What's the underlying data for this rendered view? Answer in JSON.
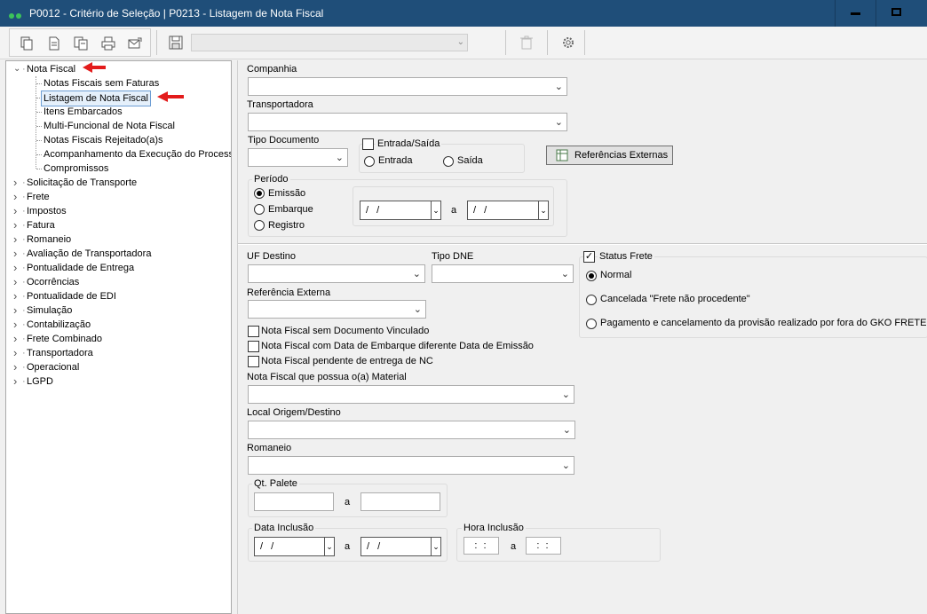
{
  "window": {
    "title": "P0012 - Critério de Seleção | P0213 - Listagem de Nota Fiscal",
    "accent": "#1f4e79"
  },
  "toolbar": {
    "icons": [
      "copy-icon",
      "document-icon",
      "copy-document-icon",
      "print-icon",
      "export-icon",
      "save-icon",
      "trash-icon",
      "gear-icon"
    ],
    "combo_value": ""
  },
  "tree": {
    "root": {
      "label": "Nota Fiscal",
      "expanded": true
    },
    "children": [
      "Notas Fiscais sem Faturas",
      "Listagem de Nota Fiscal",
      "Itens Embarcados",
      "Multi-Funcional de Nota Fiscal",
      "Notas Fiscais Rejeitado(a)s",
      "Acompanhamento da Execução do Processo",
      "Compromissos"
    ],
    "selected": "Listagem de Nota Fiscal",
    "other_roots": [
      "Solicitação de Transporte",
      "Frete",
      "Impostos",
      "Fatura",
      "Romaneio",
      "Avaliação de Transportadora",
      "Pontualidade de Entrega",
      "Ocorrências",
      "Pontualidade de EDI",
      "Simulação",
      "Contabilização",
      "Frete Combinado",
      "Transportadora",
      "Operacional",
      "LGPD"
    ]
  },
  "form": {
    "companhia": {
      "label": "Companhia",
      "value": ""
    },
    "transportadora": {
      "label": "Transportadora",
      "value": ""
    },
    "tipo_documento": {
      "label": "Tipo Documento",
      "value": ""
    },
    "entrada_saida": {
      "label": "Entrada/Saída",
      "checked": false,
      "options": [
        "Entrada",
        "Saída"
      ]
    },
    "referencias_externas_button": "Referências Externas",
    "periodo": {
      "label": "Período",
      "options": [
        "Emissão",
        "Embarque",
        "Registro"
      ],
      "selected": "Emissão",
      "date_from": "/ /",
      "date_to": "/ /",
      "a_label": "a"
    },
    "uf_destino": {
      "label": "UF Destino",
      "value": ""
    },
    "tipo_dne": {
      "label": "Tipo DNE",
      "value": ""
    },
    "referencia_externa": {
      "label": "Referência Externa",
      "value": ""
    },
    "status_frete": {
      "label": "Status Frete",
      "checked": true,
      "options": [
        "Normal",
        "Cancelada \"Frete não procedente\"",
        "Pagamento e cancelamento da provisão realizado por fora do GKO FRETE"
      ],
      "selected": "Normal"
    },
    "checks": [
      "Nota Fiscal sem Documento Vinculado",
      "Nota Fiscal com Data de Embarque diferente Data de Emissão",
      "Nota Fiscal pendente de entrega de NC"
    ],
    "material": {
      "label": "Nota Fiscal que possua o(a) Material",
      "value": ""
    },
    "local_origem": {
      "label": "Local Origem/Destino",
      "value": ""
    },
    "romaneio": {
      "label": "Romaneio",
      "value": ""
    },
    "qt_palete": {
      "label": "Qt. Palete",
      "from": "",
      "to": "",
      "a_label": "a"
    },
    "data_inclusao": {
      "label": "Data Inclusão",
      "from": "/ /",
      "to": "/ /",
      "a_label": "a"
    },
    "hora_inclusao": {
      "label": "Hora Inclusão",
      "from": ": :",
      "to": ": :",
      "a_label": "a"
    }
  }
}
